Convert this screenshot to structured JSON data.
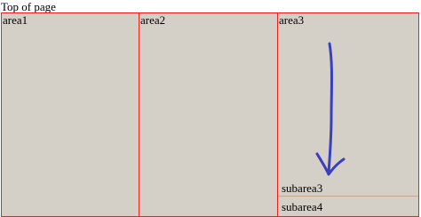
{
  "page": {
    "top_label": "Top of page"
  },
  "areas": [
    {
      "label": "area1"
    },
    {
      "label": "area2"
    },
    {
      "label": "area3"
    }
  ],
  "subareas": [
    {
      "label": "subarea3"
    },
    {
      "label": "subarea4"
    }
  ],
  "colors": {
    "area_background": "#d4d0c8",
    "area_border": "#ee2020",
    "arrow": "#3a3fbf",
    "subarea_divider": "#c8a88c"
  },
  "icons": {
    "annotation": "down-arrow-icon"
  }
}
